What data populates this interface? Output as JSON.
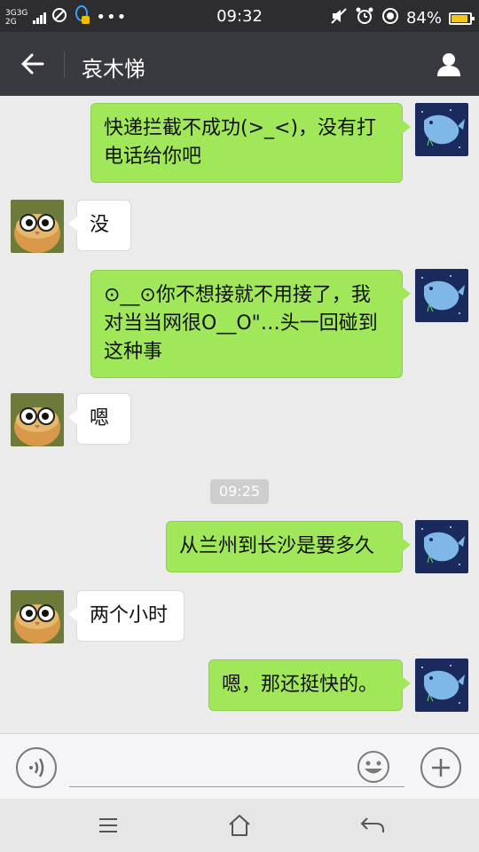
{
  "status_bar": {
    "time": "09:32",
    "network_1": "3G",
    "network_2": "3G",
    "network_3": "2G",
    "battery_percent": "84%",
    "battery_level": 0.84
  },
  "header": {
    "title": "哀木悌"
  },
  "messages": [
    {
      "sender": "me",
      "text": "快递拦截不成功(>_<)，没有打电话给你吧"
    },
    {
      "sender": "them",
      "text": "没"
    },
    {
      "sender": "me",
      "text": "⊙__⊙你不想接就不用接了，我对当当网很O__O\"…头一回碰到这种事"
    },
    {
      "sender": "them",
      "text": "嗯"
    },
    {
      "sender": "me",
      "text": "从兰州到长沙是要多久"
    },
    {
      "sender": "them",
      "text": "两个小时"
    },
    {
      "sender": "me",
      "text": "嗯，那还挺快的。"
    }
  ],
  "timestamp": "09:25",
  "input": {
    "value": "",
    "placeholder": ""
  },
  "colors": {
    "my_bubble": "#a0e75a",
    "their_bubble": "#ffffff",
    "title_bar": "#393a3f",
    "background": "#ebebeb"
  }
}
